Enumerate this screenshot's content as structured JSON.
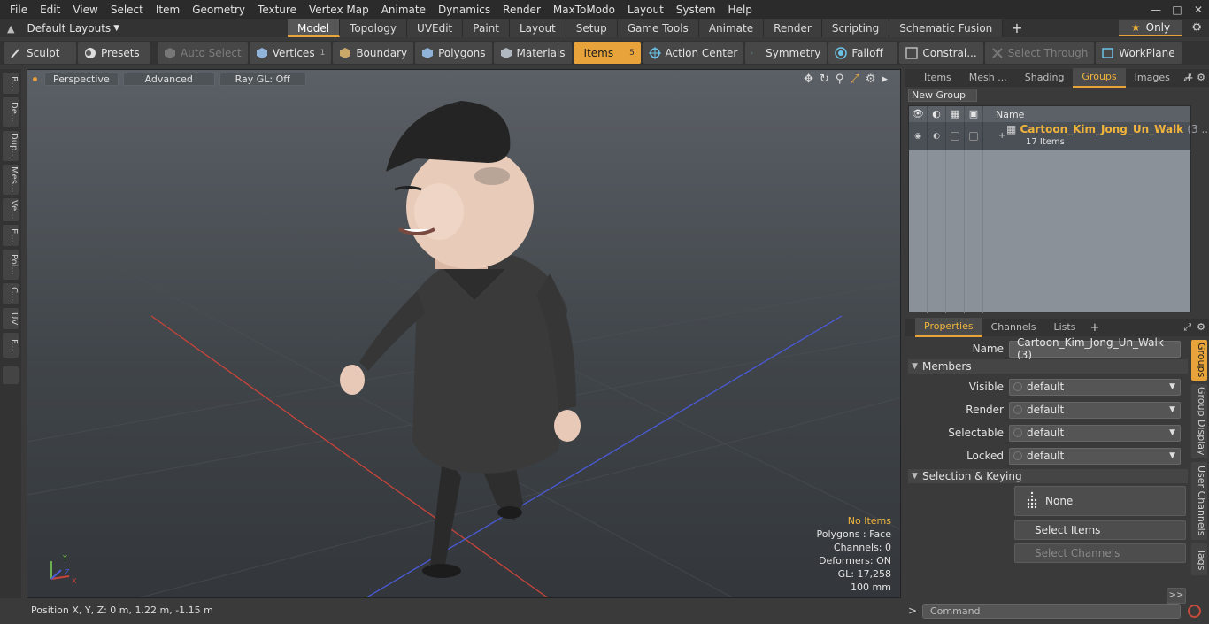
{
  "menu": [
    "File",
    "Edit",
    "View",
    "Select",
    "Item",
    "Geometry",
    "Texture",
    "Vertex Map",
    "Animate",
    "Dynamics",
    "Render",
    "MaxToModo",
    "Layout",
    "System",
    "Help"
  ],
  "layout_selector": "Default Layouts",
  "layout_tabs": [
    "Model",
    "Topology",
    "UVEdit",
    "Paint",
    "Layout",
    "Setup",
    "Game Tools",
    "Animate",
    "Render",
    "Scripting",
    "Schematic Fusion"
  ],
  "active_layout_tab": "Model",
  "only_label": "Only",
  "toolbar": {
    "sculpt": "Sculpt",
    "presets": "Presets",
    "auto_select": "Auto Select",
    "vertices": "Vertices",
    "vertices_count": "1",
    "boundary": "Boundary",
    "polygons": "Polygons",
    "materials": "Materials",
    "items": "Items",
    "items_count": "5",
    "action_center": "Action Center",
    "symmetry": "Symmetry",
    "falloff": "Falloff",
    "constraints": "Constrai...",
    "select_through": "Select Through",
    "workplane": "WorkPlane"
  },
  "left_strip": [
    "B...",
    "De...",
    "Dup...",
    "Mes...",
    "Ve...",
    "E...",
    "Pol...",
    "C...",
    "UV",
    "F..."
  ],
  "viewport": {
    "view_mode": "Perspective",
    "shading": "Advanced",
    "raygl": "Ray GL: Off",
    "info": {
      "items": "No Items",
      "polygons": "Polygons : Face",
      "channels": "Channels: 0",
      "deformers": "Deformers: ON",
      "gl": "GL: 17,258",
      "scale": "100 mm"
    },
    "axis_labels": {
      "y": "Y",
      "x": "X",
      "z": "Z"
    }
  },
  "status": "Position X, Y, Z:   0 m, 1.22 m, -1.15 m",
  "top_panel": {
    "tabs": [
      "Items",
      "Mesh ...",
      "Shading",
      "Groups",
      "Images"
    ],
    "active_tab": "Groups",
    "new_group": "New Group",
    "name_header": "Name",
    "group": {
      "name": "Cartoon_Kim_Jong_Un_Walk",
      "suffix": "(3 ...",
      "count": "17 Items"
    }
  },
  "properties": {
    "tabs": [
      "Properties",
      "Channels",
      "Lists"
    ],
    "active_tab": "Properties",
    "name_label": "Name",
    "name_value": "Cartoon_Kim_Jong_Un_Walk (3)",
    "members_section": "Members",
    "visible_label": "Visible",
    "visible_value": "default",
    "render_label": "Render",
    "render_value": "default",
    "selectable_label": "Selectable",
    "selectable_value": "default",
    "locked_label": "Locked",
    "locked_value": "default",
    "selection_section": "Selection & Keying",
    "none_button": "None",
    "select_items": "Select Items",
    "select_channels": "Select Channels",
    "expand": ">>",
    "side_tabs": [
      "Groups",
      "Group Display",
      "User Channels",
      "Tags"
    ]
  },
  "command_placeholder": "Command",
  "colors": {
    "accent": "#e8a33a",
    "group_name": "#f0b43c",
    "x_axis": "#c8443a",
    "z_axis": "#4a5ad8"
  }
}
